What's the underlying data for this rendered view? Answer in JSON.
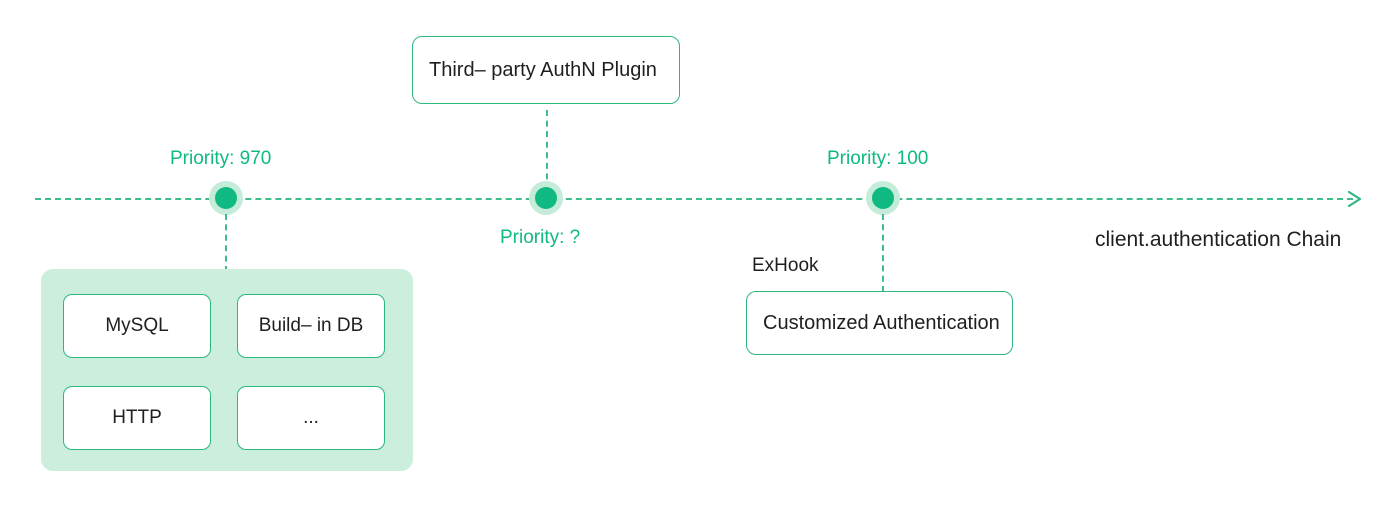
{
  "diagram": {
    "title": "client.authentication Chain",
    "axis": {
      "label": "client.authentication Chain",
      "arrow_icon": "arrow-right-icon",
      "line_style": "dashed",
      "color": "#3dbd8a"
    },
    "colors": {
      "accent": "#10b981",
      "accent_border": "#2eb87e",
      "accent_light": "#cbeedd",
      "node_halo": "#c4ecd9",
      "card_shadow": "#9fdfc1",
      "group_card_shadow": "#72ceaa",
      "text": "#1f1f1f"
    },
    "nodes": [
      {
        "id": "node-970",
        "priority_label": "Priority: 970",
        "label_position": "above"
      },
      {
        "id": "node-unknown",
        "priority_label": "Priority: ?",
        "label_position": "below"
      },
      {
        "id": "node-100",
        "priority_label": "Priority: 100",
        "label_position": "above"
      }
    ],
    "cards": {
      "third_party_plugin": {
        "label": "Third– party AuthN Plugin"
      },
      "customized_auth": {
        "label": "Customized Authentication",
        "annotation": "ExHook"
      }
    },
    "backend_group": {
      "items": [
        {
          "label": "MySQL"
        },
        {
          "label": "Build– in DB"
        },
        {
          "label": "HTTP"
        },
        {
          "label": "..."
        }
      ]
    }
  }
}
